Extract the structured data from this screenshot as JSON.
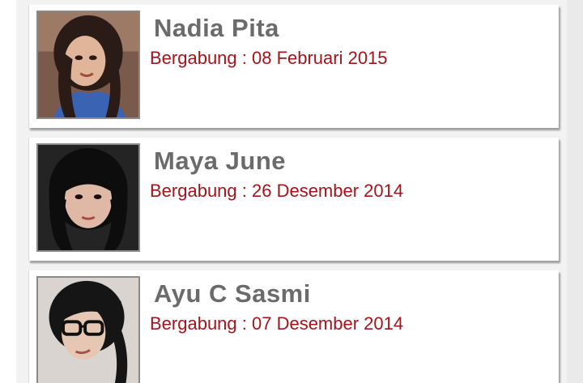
{
  "members": [
    {
      "name": "Nadia Pita",
      "joined": "Bergabung : 08 Februari 2015"
    },
    {
      "name": "Maya June",
      "joined": "Bergabung : 26 Desember 2014"
    },
    {
      "name": "Ayu C Sasmi",
      "joined": "Bergabung : 07 Desember 2014"
    }
  ],
  "colors": {
    "name_text": "#6b6b6b",
    "joined_text": "#a3141b",
    "card_bg": "#ffffff",
    "page_bg": "#f2f2f2"
  }
}
